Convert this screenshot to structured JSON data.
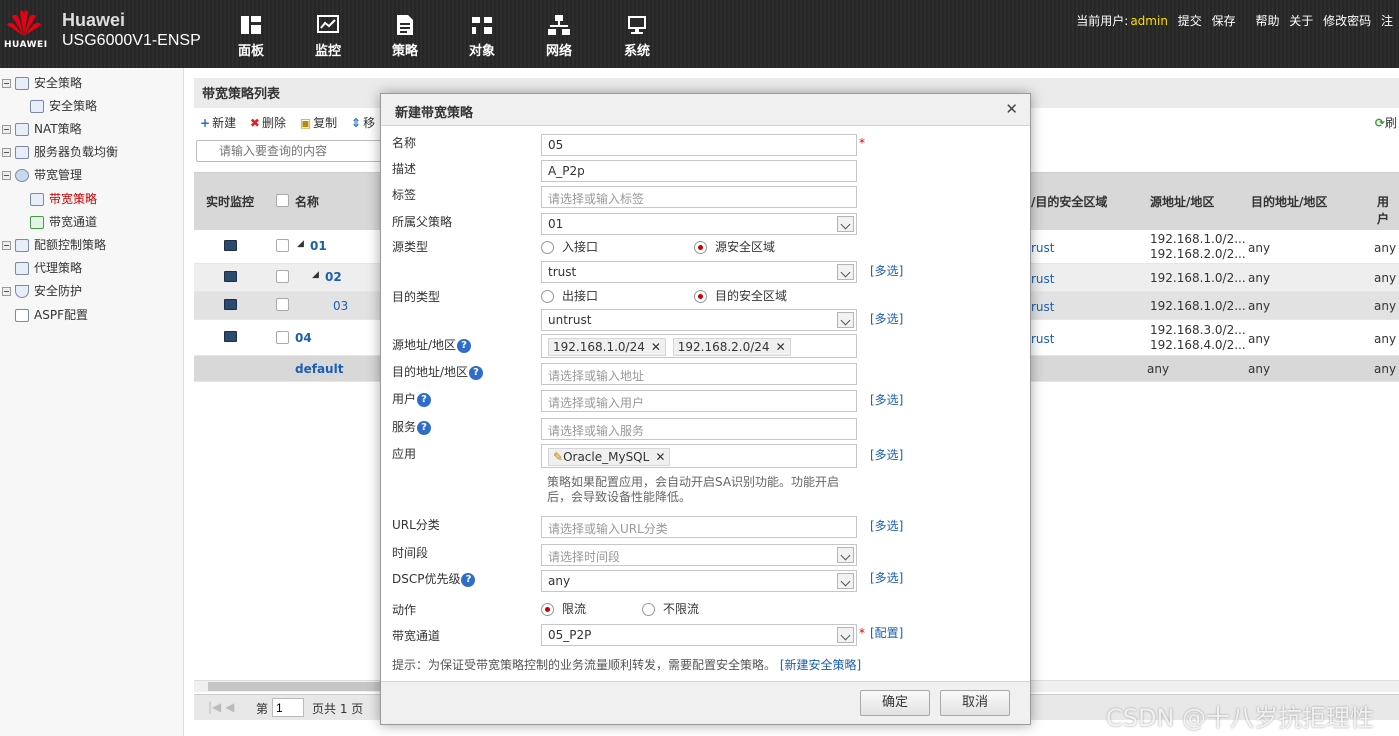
{
  "header": {
    "brand": "Huawei",
    "logo_text": "HUAWEI",
    "model": "USG6000V1-ENSP",
    "nav": [
      "面板",
      "监控",
      "策略",
      "对象",
      "网络",
      "系统"
    ],
    "user_prefix": "当前用户:",
    "user": "admin",
    "links": [
      "提交",
      "保存",
      "帮助",
      "关于",
      "修改密码",
      "注"
    ]
  },
  "sidebar": {
    "items": [
      {
        "label": "安全策略"
      },
      {
        "label": "安全策略"
      },
      {
        "label": "NAT策略"
      },
      {
        "label": "服务器负载均衡"
      },
      {
        "label": "带宽管理"
      },
      {
        "label": "带宽策略"
      },
      {
        "label": "带宽通道"
      },
      {
        "label": "配额控制策略"
      },
      {
        "label": "代理策略"
      },
      {
        "label": "安全防护"
      },
      {
        "label": "ASPF配置"
      }
    ]
  },
  "main": {
    "title": "带宽策略列表",
    "toolbar": {
      "new": "新建",
      "delete": "删除",
      "copy": "复制",
      "move": "移",
      "refresh": "刷"
    },
    "search_placeholder": "请输入要查询的内容",
    "columns": {
      "monitor": "实时监控",
      "name": "名称",
      "zone": "/目的安全区域",
      "src": "源地址/地区",
      "dst": "目的地址/地区",
      "user": "用户"
    },
    "rows": [
      {
        "name": "01",
        "zone": "rust",
        "src1": "192.168.1.0/2...",
        "src2": "192.168.2.0/2...",
        "dst": "any",
        "user": "any"
      },
      {
        "name": "02",
        "zone": "rust",
        "src1": "192.168.1.0/2...",
        "src2": "",
        "dst": "any",
        "user": "any"
      },
      {
        "name": "03",
        "zone": "rust",
        "src1": "192.168.1.0/2...",
        "src2": "",
        "dst": "any",
        "user": "any"
      },
      {
        "name": "04",
        "zone": "rust",
        "src1": "192.168.3.0/2...",
        "src2": "192.168.4.0/2...",
        "dst": "any",
        "user": "any"
      },
      {
        "name": "default",
        "zone": "",
        "src1": "any",
        "src2": "",
        "dst": "any",
        "user": "any"
      }
    ],
    "pager": {
      "page_label": "第",
      "page_value": "1",
      "total": "页共 1 页"
    }
  },
  "dialog": {
    "title": "新建带宽策略",
    "fields": {
      "name": {
        "label": "名称",
        "value": "05"
      },
      "desc": {
        "label": "描述",
        "value": "A_P2p"
      },
      "tag": {
        "label": "标签",
        "placeholder": "请选择或输入标签"
      },
      "parent": {
        "label": "所属父策略",
        "value": "01"
      },
      "src_type": {
        "label": "源类型",
        "opt1": "入接口",
        "opt2": "源安全区域",
        "value": "trust"
      },
      "dst_type": {
        "label": "目的类型",
        "opt1": "出接口",
        "opt2": "目的安全区域",
        "value": "untrust"
      },
      "src_addr": {
        "label": "源地址/地区",
        "tags": [
          "192.168.1.0/24",
          "192.168.2.0/24"
        ]
      },
      "dst_addr": {
        "label": "目的地址/地区",
        "placeholder": "请选择或输入地址"
      },
      "user": {
        "label": "用户",
        "placeholder": "请选择或输入用户"
      },
      "service": {
        "label": "服务",
        "placeholder": "请选择或输入服务"
      },
      "app": {
        "label": "应用",
        "tag": "Oracle_MySQL"
      },
      "app_note": "策略如果配置应用，会自动开启SA识别功能。功能开启后，会导致设备性能降低。",
      "url": {
        "label": "URL分类",
        "placeholder": "请选择或输入URL分类"
      },
      "time": {
        "label": "时间段",
        "placeholder": "请选择时间段"
      },
      "dscp": {
        "label": "DSCP优先级",
        "value": "any"
      },
      "action": {
        "label": "动作",
        "opt1": "限流",
        "opt2": "不限流"
      },
      "channel": {
        "label": "带宽通道",
        "value": "05_P2P"
      }
    },
    "multi": "[多选]",
    "config": "[配置]",
    "required": "*",
    "tip": "提示：为保证受带宽策略控制的业务流量顺利转发，需要配置安全策略。",
    "tip_link": "[新建安全策略]",
    "ok": "确定",
    "cancel": "取消"
  },
  "watermark": "CSDN @十八岁抗拒理性",
  "colors": {
    "accent": "#c00000",
    "link": "#1a5fb4",
    "header_bg": "#2b2b2b",
    "user_highlight": "#ffde00"
  }
}
